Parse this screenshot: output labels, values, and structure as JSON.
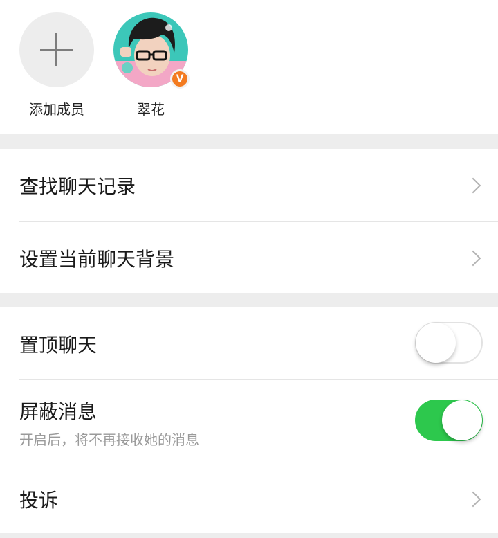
{
  "members": {
    "add_label": "添加成员",
    "member_name": "翠花",
    "badge_text": "V"
  },
  "chat_tools": {
    "search_history_label": "查找聊天记录",
    "set_background_label": "设置当前聊天背景"
  },
  "settings": {
    "pin_chat": {
      "label": "置顶聊天",
      "enabled": false
    },
    "block_messages": {
      "label": "屏蔽消息",
      "subtitle": "开启后，将不再接收她的消息",
      "enabled": true
    },
    "report_label": "投诉"
  },
  "colors": {
    "toggle_on": "#2dc84d",
    "badge": "#f37b20",
    "avatar_bg": "#3cc7b9"
  }
}
